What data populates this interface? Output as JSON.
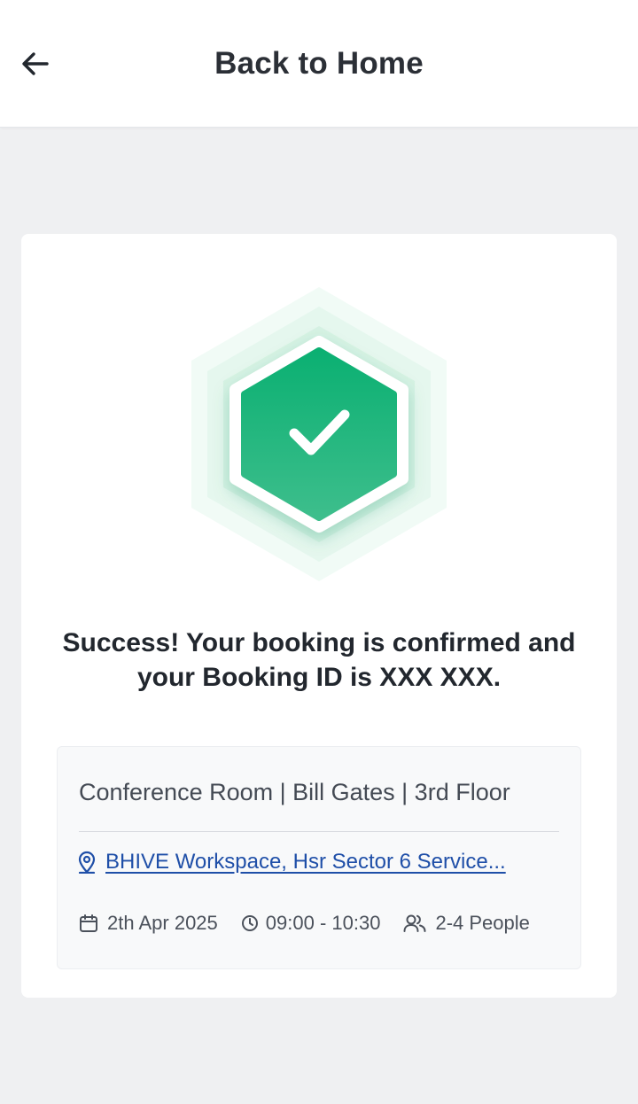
{
  "header": {
    "title": "Back to Home",
    "back_icon": "arrow-left-icon"
  },
  "success": {
    "icon": "check-hexagon-icon",
    "accent_color": "#12b377",
    "message": "Success! Your booking is confirmed and your Booking ID is XXX XXX."
  },
  "booking": {
    "room": "Conference Room | Bill Gates | 3rd Floor",
    "location_icon": "map-pin-icon",
    "location": "BHIVE Workspace, Hsr Sector 6 Service...",
    "date_icon": "calendar-icon",
    "date": "2th Apr 2025",
    "time_icon": "clock-icon",
    "time": "09:00 - 10:30",
    "people_icon": "users-icon",
    "people": "2-4 People"
  }
}
